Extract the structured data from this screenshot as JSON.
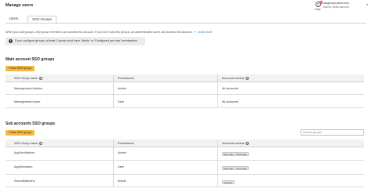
{
  "page": {
    "title": "Manage users"
  },
  "header": {
    "help_label": "Help",
    "notification_count": "1",
    "account_name": "ssogroups-demo-mai...",
    "account_role": "Admin",
    "account_sub": "Main account"
  },
  "tabs": [
    {
      "label": "Users"
    },
    {
      "label": "SSO Groups"
    }
  ],
  "notice": {
    "text": "When you add groups, only group members can access this account. If you don't add any groups, all authenticated users can access this account.",
    "link": "Learn more"
  },
  "info": {
    "text": "If you configure groups, at least 1 group must have 'Admin' or 'Configured per user' permissions"
  },
  "main_section": {
    "title": "Main account SSO groups",
    "new_button": "+ New SSO group",
    "columns": [
      "SSO Group name",
      "Permissions",
      "Accounts access"
    ],
    "rows": [
      {
        "name": "Management-Admins",
        "permission": "Admin",
        "access": "All accounts"
      },
      {
        "name": "Management-Users",
        "permission": "User",
        "access": "All accounts"
      }
    ]
  },
  "sub_section": {
    "title": "Sub accounts SSO groups",
    "new_button": "+ New SSO group",
    "search_placeholder": "Search groups",
    "columns": [
      "SSO Group name",
      "Permissions",
      "Accounts access"
    ],
    "rows": [
      {
        "name": "AppDevAdmins",
        "permission": "Admin",
        "tags": [
          "Dev-App",
          "Prod-App"
        ]
      },
      {
        "name": "AppDevUsers",
        "permission": "User",
        "tags": [
          "Dev-App",
          "Prod-App"
        ]
      },
      {
        "name": "SecurityAdmins",
        "permission": "Admin",
        "tags": [
          "Security"
        ]
      }
    ]
  },
  "colors": {
    "accent": "#f5b942",
    "link": "#2f72d5"
  }
}
